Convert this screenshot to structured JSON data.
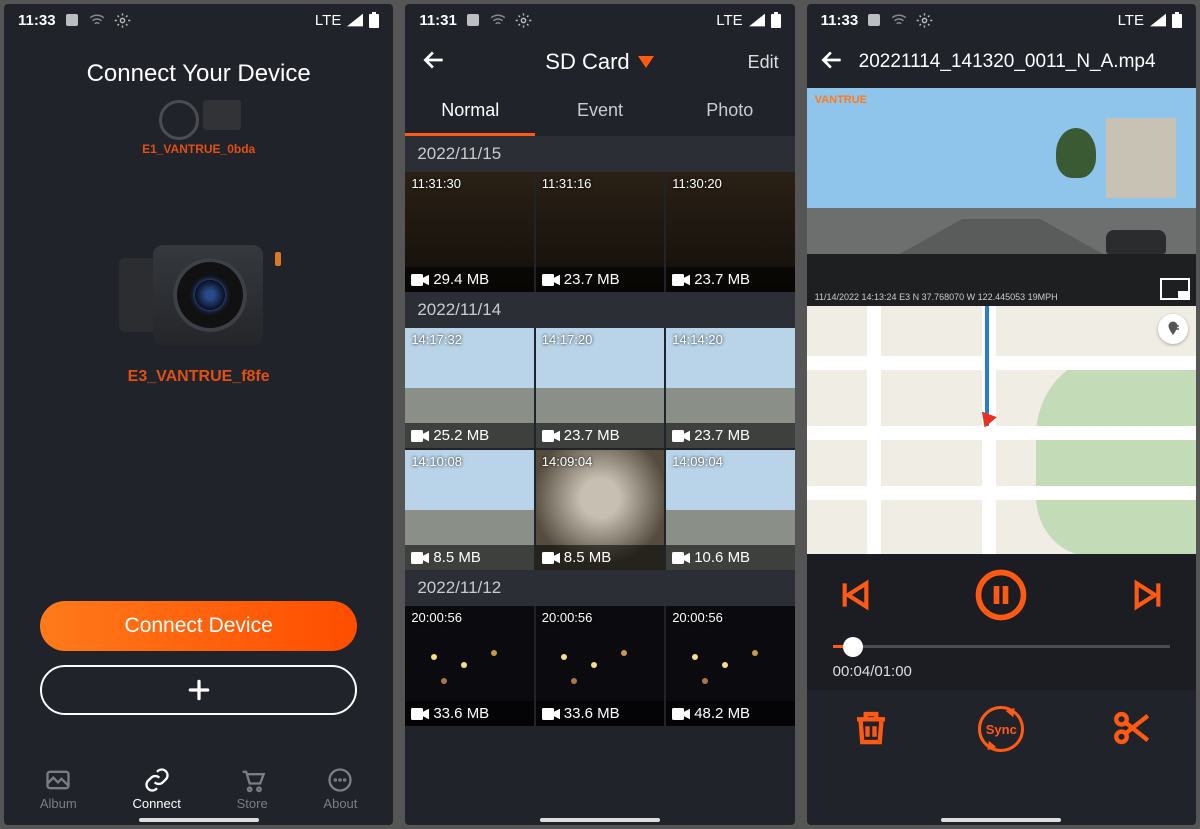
{
  "status": {
    "time1": "11:33",
    "time2": "11:31",
    "time3": "11:33",
    "net": "LTE"
  },
  "s1": {
    "title": "Connect Your Device",
    "dev_small": "E1_VANTRUE_0bda",
    "dev_big": "E3_VANTRUE_f8fe",
    "connect": "Connect Device",
    "tabs": {
      "album": "Album",
      "connect": "Connect",
      "store": "Store",
      "about": "About"
    }
  },
  "s2": {
    "title": "SD Card",
    "edit": "Edit",
    "tabs": {
      "normal": "Normal",
      "event": "Event",
      "photo": "Photo"
    },
    "groups": [
      {
        "date": "2022/11/15",
        "items": [
          {
            "ts": "11:31:30",
            "sz": "29.4 MB",
            "k": "dark"
          },
          {
            "ts": "11:31:16",
            "sz": "23.7 MB",
            "k": "dark"
          },
          {
            "ts": "11:30:20",
            "sz": "23.7 MB",
            "k": "dark"
          }
        ]
      },
      {
        "date": "2022/11/14",
        "items": [
          {
            "ts": "14:17:32",
            "sz": "25.2 MB",
            "k": "sky"
          },
          {
            "ts": "14:17:20",
            "sz": "23.7 MB",
            "k": "sky"
          },
          {
            "ts": "14:14:20",
            "sz": "23.7 MB",
            "k": "sky"
          },
          {
            "ts": "14:10:08",
            "sz": "8.5 MB",
            "k": "sky"
          },
          {
            "ts": "14:09:04",
            "sz": "8.5 MB",
            "k": "interior"
          },
          {
            "ts": "14:09:04",
            "sz": "10.6 MB",
            "k": "sky"
          }
        ]
      },
      {
        "date": "2022/11/12",
        "items": [
          {
            "ts": "20:00:56",
            "sz": "33.6 MB",
            "k": "night"
          },
          {
            "ts": "20:00:56",
            "sz": "33.6 MB",
            "k": "night"
          },
          {
            "ts": "20:00:56",
            "sz": "48.2 MB",
            "k": "night"
          }
        ]
      }
    ]
  },
  "s3": {
    "filename": "20221114_141320_0011_N_A.mp4",
    "brand": "VANTRUE",
    "meta": "11/14/2022  14:13:24 E3  N 37.768070  W 122.445053  19MPH",
    "time": "00:04/01:00",
    "sync": "Sync"
  }
}
